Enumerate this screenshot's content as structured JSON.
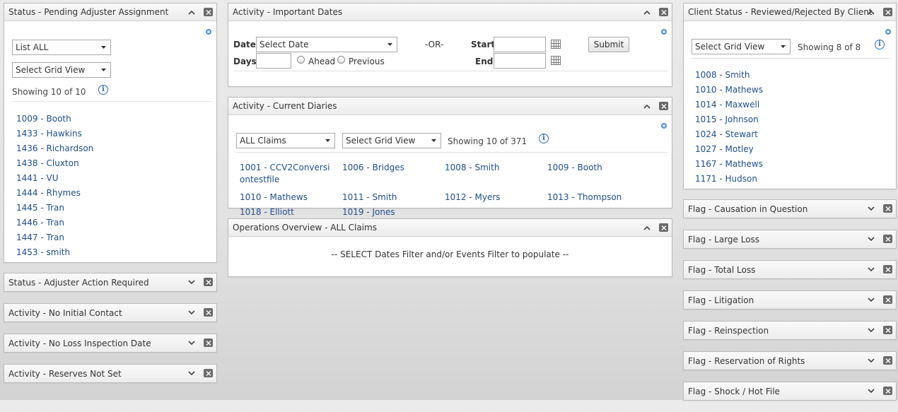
{
  "left": {
    "pending": {
      "title": "Status - Pending Adjuster Assignment",
      "list_select": "List ALL",
      "grid_select": "Select Grid View",
      "showing": "Showing  10 of 10",
      "items": [
        "1009 - Booth",
        "1433 - Hawkins",
        "1436 - Richardson",
        "1438 - Cluxton",
        "1441 - VU",
        "1444 - Rhymes",
        "1445 - Tran",
        "1446 - Tran",
        "1447 - Tran",
        "1453 - smith"
      ]
    },
    "collapsed": [
      "Status - Adjuster Action Required",
      "Activity - No Initial Contact",
      "Activity - No Loss Inspection Date",
      "Activity - Reserves Not Set"
    ]
  },
  "middle": {
    "dates": {
      "title": "Activity - Important Dates",
      "date_label": "Date:",
      "date_select": "Select Date",
      "or_label": "-OR-",
      "start_label": "Start:",
      "end_label": "End:",
      "days_label": "Days:",
      "ahead_label": "Ahead",
      "previous_label": "Previous",
      "submit_label": "Submit"
    },
    "diaries": {
      "title": "Activity - Current Diaries",
      "claims_select": "ALL Claims",
      "grid_select": "Select Grid View",
      "showing": "Showing  10 of 371",
      "items": [
        "1001 - CCV2Conversiontestfile",
        "1006 - Bridges",
        "1008 - Smith",
        "1009 - Booth",
        "1010 - Mathews",
        "1011 - Smith",
        "1012 - Myers",
        "1013 - Thompson",
        "1018 - Elliott",
        "1019 - Jones"
      ]
    },
    "operations": {
      "title": "Operations Overview - ALL Claims",
      "message": "-- SELECT Dates Filter and/or Events Filter to populate --"
    }
  },
  "right": {
    "client": {
      "title": "Client Status - Reviewed/Rejected By Client",
      "grid_select": "Select Grid View",
      "showing": "Showing  8 of 8",
      "items": [
        "1008 - Smith",
        "1010 - Mathews",
        "1014 - Maxwell",
        "1015 - Johnson",
        "1024 - Stewart",
        "1027 - Motley",
        "1167 - Mathews",
        "1171 - Hudson"
      ]
    },
    "collapsed": [
      "Flag - Causation in Question",
      "Flag - Large Loss",
      "Flag - Total Loss",
      "Flag - Litigation",
      "Flag - Reinspection",
      "Flag - Reservation of Rights",
      "Flag - Shock / Hot File"
    ]
  },
  "icons": {
    "collapse": "chevron-up-icon",
    "expand": "chevron-down-icon",
    "close": "close-icon",
    "settings": "gear-icon",
    "info": "info-icon",
    "calendar": "calendar-icon",
    "dropdown": "dropdown-arrow-icon"
  },
  "colors": {
    "link": "#1f4e8c",
    "info": "#2f6bc4",
    "panel_header": "#ececec",
    "close_button": "#6a6a6a"
  }
}
